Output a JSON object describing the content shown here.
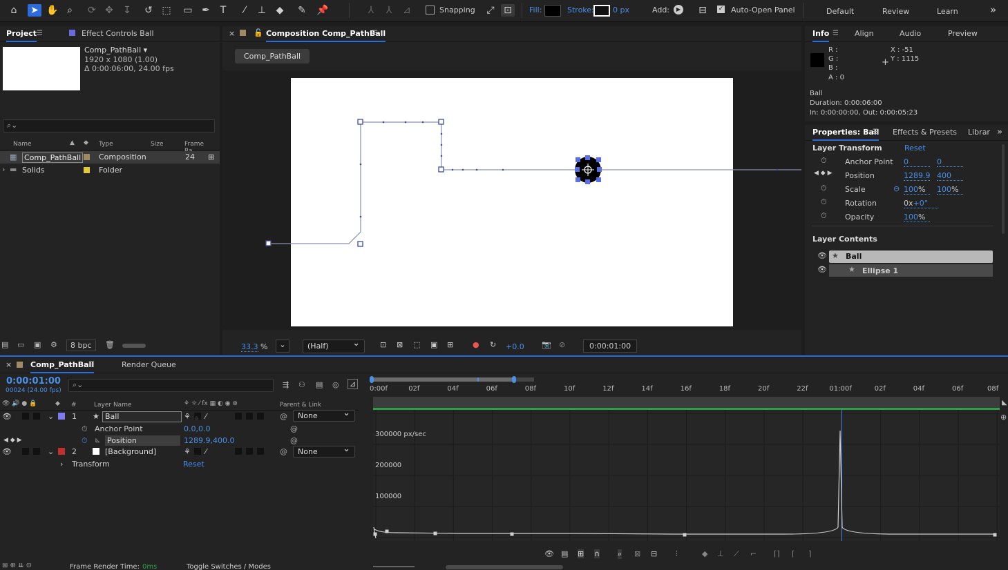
{
  "toolbar": {
    "snapping_label": "Snapping",
    "fill_label": "Fill:",
    "stroke_label": "Stroke:",
    "stroke_px": "0 px",
    "add_label": "Add:",
    "auto_open_label": "Auto-Open Panel",
    "workspaces": [
      "Default",
      "Review",
      "Learn"
    ],
    "more": "»"
  },
  "project_panel": {
    "tab_project": "Project",
    "tab_effect_controls": "Effect Controls Ball",
    "item_name": "Comp_PathBall ▾",
    "item_dims": "1920 x 1080 (1.00)",
    "item_duration": "Δ 0:00:06:00, 24.00 fps",
    "search_placeholder": "",
    "columns": [
      "Name",
      "Type",
      "Size",
      "Frame Ra..."
    ],
    "rows": [
      {
        "name": "Comp_PathBall",
        "type": "Composition",
        "size": "",
        "fps": "24",
        "color": "#a08a66"
      },
      {
        "name": "Solids",
        "type": "Folder",
        "size": "",
        "fps": "",
        "color": "#e2c93a"
      }
    ],
    "bpc": "8 bpc"
  },
  "comp_panel": {
    "title": "Composition Comp_PathBall",
    "sub_tab": "Comp_PathBall",
    "zoom_value": "33.3",
    "zoom_unit": "%",
    "resolution": "(Half)",
    "exposure": "+0.0",
    "timecode": "0:00:01:00"
  },
  "info_panel": {
    "tabs": [
      "Info",
      "Align",
      "Audio",
      "Preview"
    ],
    "r": "R :",
    "g": "G :",
    "b": "B :",
    "a": "A :  0",
    "x": "X :  -51",
    "y": "Y :  1115",
    "layer_name": "Ball",
    "duration": "Duration: 0:00:06:00",
    "in_out": "In: 0:00:00:00, Out: 0:00:05:23"
  },
  "properties_panel": {
    "tabs": [
      "Properties: Ball",
      "Effects & Presets",
      "Librar"
    ],
    "section_transform": "Layer Transform",
    "reset": "Reset",
    "props": [
      {
        "label": "Anchor Point",
        "v1": "0",
        "v2": "0"
      },
      {
        "label": "Position",
        "v1": "1289.9",
        "v2": "400"
      },
      {
        "label": "Scale",
        "v1": "100",
        "v2": "100",
        "unit": "%"
      },
      {
        "label": "Rotation",
        "v1": "0x",
        "v2": "+0°"
      },
      {
        "label": "Opacity",
        "v1": "100",
        "unit": "%"
      }
    ],
    "section_contents": "Layer Contents",
    "contents": [
      "Ball",
      "Ellipse 1"
    ]
  },
  "timeline": {
    "tab_comp": "Comp_PathBall",
    "tab_render": "Render Queue",
    "timecode": "0:00:01:00",
    "frame_info": "00024 (24.00 fps)",
    "col_layer_name": "Layer Name",
    "col_hash": "#",
    "col_parent": "Parent & Link",
    "layers": [
      {
        "num": "1",
        "name": "Ball",
        "parent": "None",
        "color": "#7c7cf0"
      },
      {
        "num": "2",
        "name": "[Background]",
        "parent": "None",
        "color": "#c03030"
      }
    ],
    "anchor_label": "Anchor Point",
    "anchor_value": "0.0,0.0",
    "position_label": "Position",
    "position_value": "1289.9,400.0",
    "transform_label": "Transform",
    "transform_reset": "Reset",
    "ruler_ticks": [
      "0:00f",
      "02f",
      "04f",
      "06f",
      "08f",
      "10f",
      "12f",
      "14f",
      "16f",
      "18f",
      "20f",
      "22f",
      "01:00f",
      "02f",
      "04f",
      "06f",
      "08f"
    ],
    "graph_labels": [
      "300000 px/sec",
      "200000",
      "100000"
    ],
    "frame_render_label": "Frame Render Time:",
    "frame_render_value": "0ms",
    "toggle_label": "Toggle Switches / Modes"
  }
}
